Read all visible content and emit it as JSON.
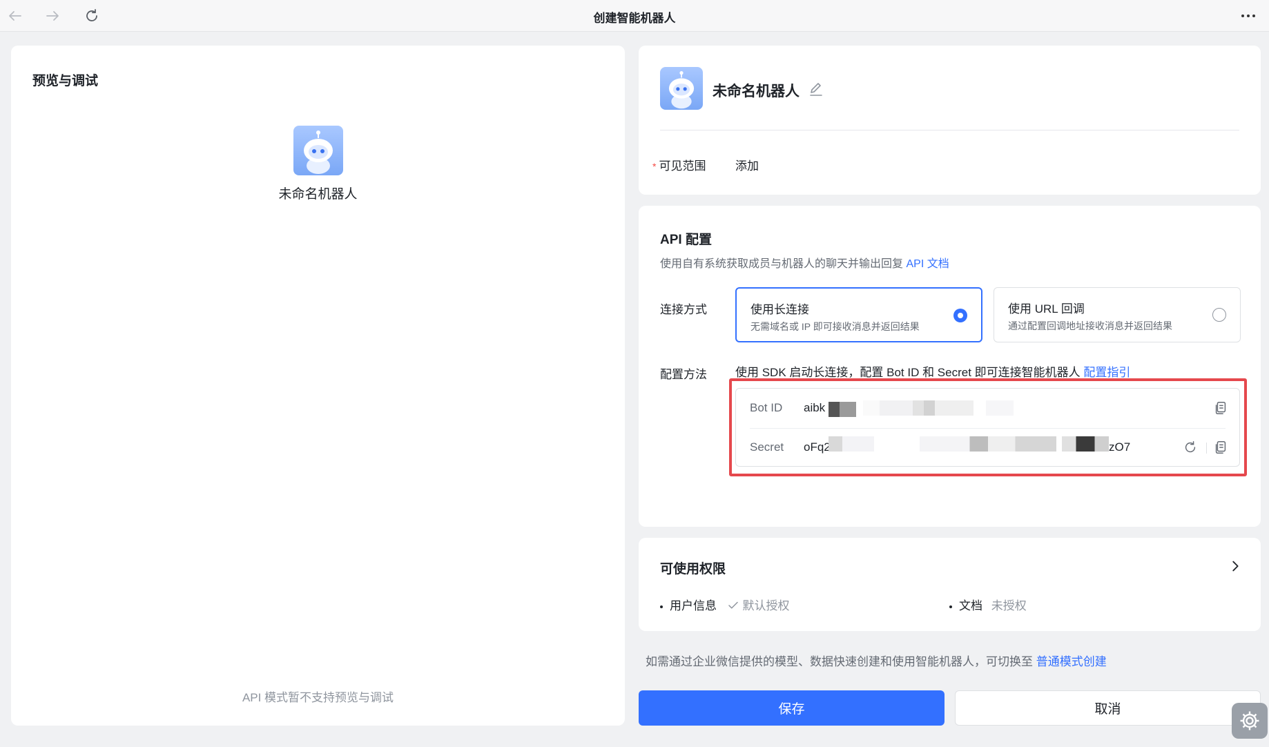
{
  "window": {
    "title": "创建智能机器人"
  },
  "preview": {
    "heading": "预览与调试",
    "bot_name": "未命名机器人",
    "footer_note": "API 模式暂不支持预览与调试"
  },
  "bot": {
    "name": "未命名机器人",
    "visibility_label": "可见范围",
    "visibility_required_mark": "*",
    "visibility_action": "添加"
  },
  "api": {
    "title": "API 配置",
    "description": "使用自有系统获取成员与机器人的聊天并输出回复",
    "doc_link": "API 文档",
    "connection_label": "连接方式",
    "options": [
      {
        "title": "使用长连接",
        "subtitle": "无需域名或 IP 即可接收消息并返回结果",
        "selected": true
      },
      {
        "title": "使用 URL 回调",
        "subtitle": "通过配置回调地址接收消息并返回结果",
        "selected": false
      }
    ],
    "config_label": "配置方法",
    "config_desc": "使用 SDK 启动长连接，配置 Bot ID 和 Secret 即可连接智能机器人",
    "config_link": "配置指引",
    "bot_id_label": "Bot ID",
    "bot_id_visible": "aibk",
    "secret_label": "Secret",
    "secret_prefix": "oFq2",
    "secret_suffix": "zO7"
  },
  "permissions": {
    "title": "可使用权限",
    "items": [
      {
        "name": "用户信息",
        "status": "默认授权"
      },
      {
        "name": "文档",
        "status": "未授权"
      }
    ]
  },
  "hint": {
    "text": "如需通过企业微信提供的模型、数据快速创建和使用智能机器人，可切换至",
    "link": "普通模式创建"
  },
  "actions": {
    "save": "保存",
    "cancel": "取消"
  },
  "colors": {
    "accent": "#3370ff",
    "highlight": "#e5484d",
    "required": "#f54a45"
  },
  "icons": [
    "back-arrow-icon",
    "forward-arrow-icon",
    "refresh-icon",
    "more-icon",
    "edit-icon",
    "copy-icon",
    "chevron-right-icon",
    "check-icon",
    "settings-icon"
  ]
}
